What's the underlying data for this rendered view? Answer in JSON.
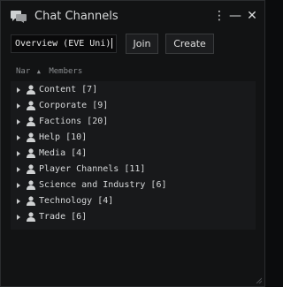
{
  "window": {
    "title": "Chat Channels",
    "menu_label": "⋮",
    "minimize_label": "—",
    "close_label": "✕"
  },
  "search": {
    "value": "Overview (EVE Uni)"
  },
  "buttons": {
    "join_label": "Join",
    "create_label": "Create"
  },
  "columns": {
    "name_label": "Nar",
    "sort_indicator": "▲",
    "members_label": "Members"
  },
  "channels": [
    {
      "label": "Content [7]"
    },
    {
      "label": "Corporate [9]"
    },
    {
      "label": "Factions [20]"
    },
    {
      "label": "Help [10]"
    },
    {
      "label": "Media [4]"
    },
    {
      "label": "Player Channels [11]"
    },
    {
      "label": "Science and Industry [6]"
    },
    {
      "label": "Technology [4]"
    },
    {
      "label": "Trade [6]"
    }
  ],
  "icons": {
    "title": "chat-bubbles-icon",
    "row_expand": "triangle-right-icon",
    "row_person": "person-icon"
  }
}
